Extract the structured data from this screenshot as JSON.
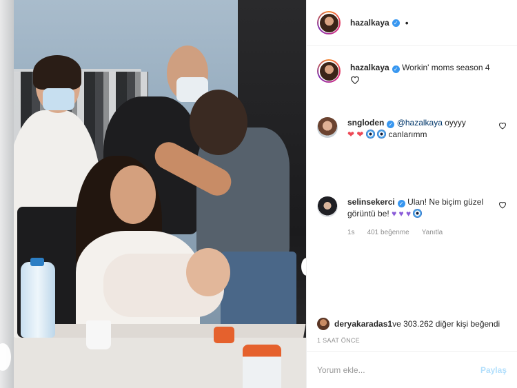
{
  "header": {
    "username": "hazalkaya",
    "separator": "•"
  },
  "caption": {
    "username": "hazalkaya",
    "text": "Workin' moms season 4"
  },
  "comments": [
    {
      "username": "sngloden",
      "mention": "@hazalkaya",
      "text_1": " oyyyy",
      "emojis": [
        "red-heart",
        "red-heart",
        "nazar-amulet",
        "nazar-amulet"
      ],
      "text_2": "canlarımm"
    },
    {
      "username": "selinsekerci",
      "text": "Ulan! Ne biçim güzel görüntü be!",
      "emojis": [
        "purple-heart",
        "purple-heart",
        "purple-heart",
        "nazar-amulet"
      ],
      "meta": {
        "time": "1s",
        "likes": "401 beğenme",
        "reply": "Yanıtla"
      }
    }
  ],
  "likes": {
    "username": "deryakaradas1",
    "text": " ve 303.262 diğer kişi beğendi"
  },
  "time_ago": "1 SAAT ÖNCE",
  "add_comment": {
    "placeholder": "Yorum ekle...",
    "post_label": "Paylaş"
  },
  "colors": {
    "verified": "#3897f0",
    "link": "#00376b",
    "post_disabled": "#b2dffc",
    "muted": "#8e8e8e"
  }
}
